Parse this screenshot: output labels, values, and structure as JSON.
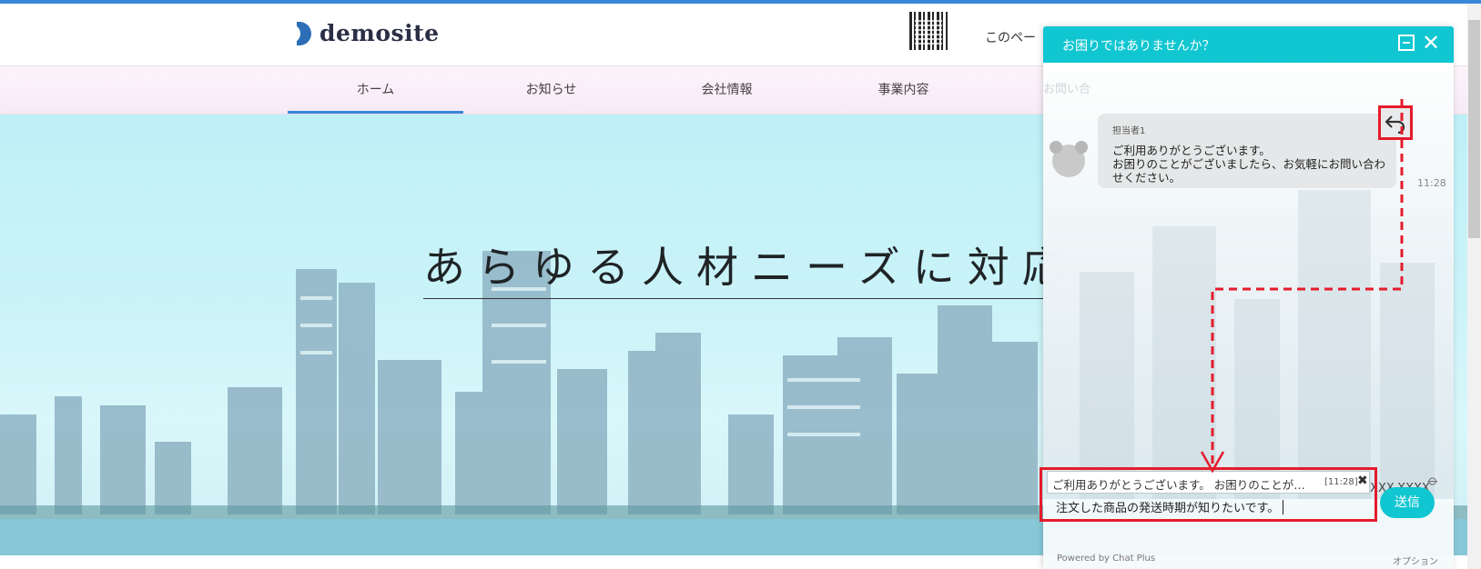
{
  "site": {
    "logo_text": "demosite",
    "header_link": "このペー",
    "nav": [
      "ホーム",
      "お知らせ",
      "会社情報",
      "事業内容"
    ],
    "hero_title": "あらゆる人材ニーズに対応"
  },
  "chat": {
    "header_title": "お困りではありませんか？",
    "partial_nav_text": "お問い合",
    "message": {
      "author": "担当者1",
      "lines": [
        "ご利用ありがとうございます。",
        "お困りのことがございましたら、お気軽にお問い合わ",
        "せください。"
      ],
      "time": "11:28"
    },
    "phone": "XXX-XXXX-XXXX",
    "quote": {
      "text": "ご利用ありがとうございます。 お困りのことが…",
      "time": "[11:28]"
    },
    "input_value": "注文した商品の発送時期が知りたいです。",
    "send_label": "送信",
    "powered_by": "Powered by Chat Plus",
    "options_label": "オプション"
  },
  "colors": {
    "accent": "#10c6d1",
    "highlight": "#e51b2b",
    "nav_active": "#3a87d8"
  }
}
